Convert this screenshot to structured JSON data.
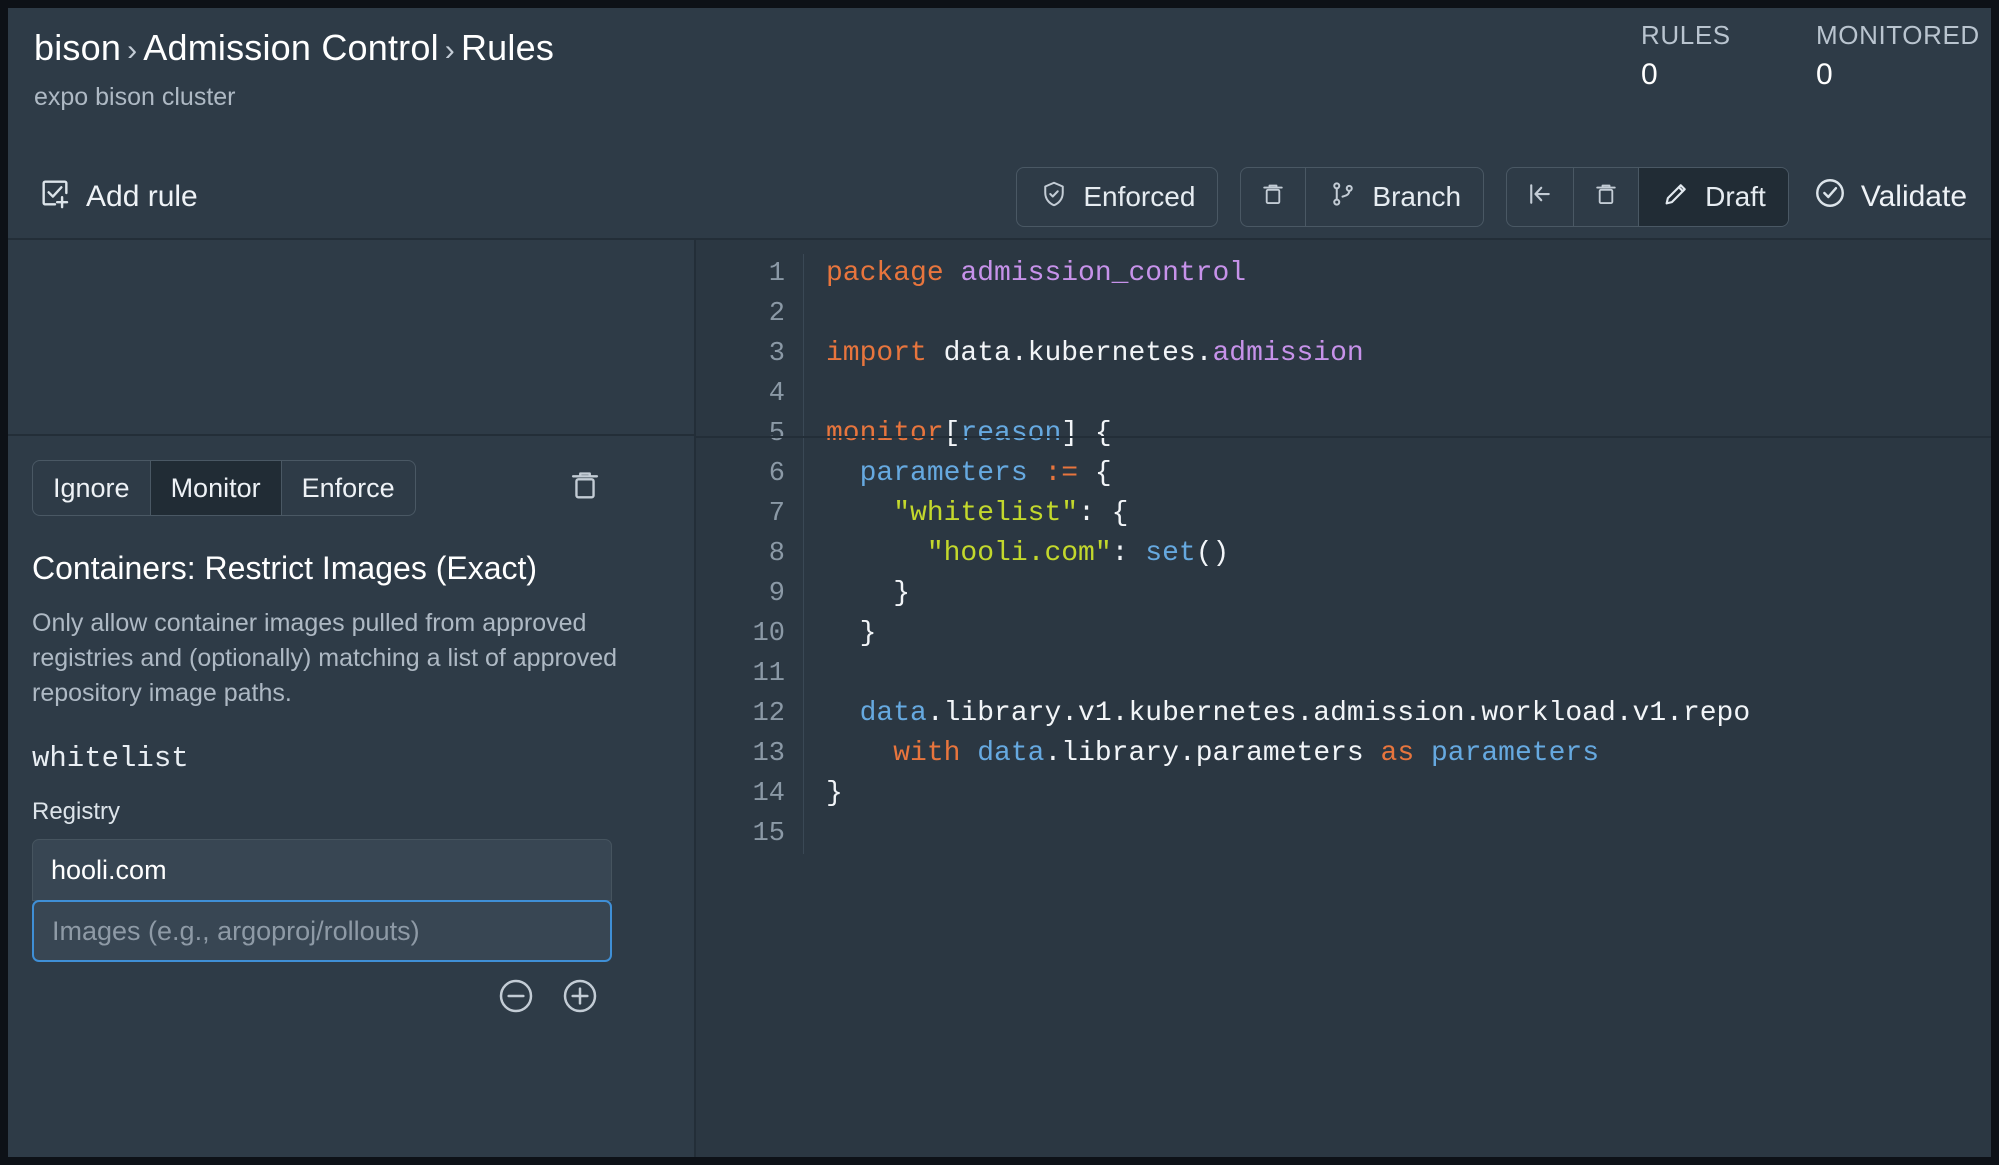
{
  "header": {
    "breadcrumb": [
      "bison",
      "Admission Control",
      "Rules"
    ],
    "separator": "›",
    "subtitle": "expo bison cluster",
    "stats": [
      {
        "label": "RULES",
        "value": "0"
      },
      {
        "label": "MONITORED",
        "value": "0"
      }
    ]
  },
  "toolbar": {
    "add_rule": "Add rule",
    "enforced": "Enforced",
    "branch": "Branch",
    "draft": "Draft",
    "validate": "Validate"
  },
  "rule": {
    "modes": [
      "Ignore",
      "Monitor",
      "Enforce"
    ],
    "active_mode": "Monitor",
    "title": "Containers: Restrict Images (Exact)",
    "description": "Only allow container images pulled from approved registries and (optionally) matching a list of approved repository image paths.",
    "param_name": "whitelist",
    "field_label": "Registry",
    "registry_value": "hooli.com",
    "images_placeholder": "Images (e.g., argoproj/rollouts)"
  },
  "editor": {
    "line_numbers": [
      "1",
      "2",
      "3",
      "4",
      "5",
      "6",
      "7",
      "8",
      "9",
      "10",
      "11",
      "12",
      "13",
      "14",
      "15"
    ],
    "lines": [
      [
        {
          "t": "package",
          "c": "kw"
        },
        {
          "t": " ",
          "c": "def"
        },
        {
          "t": "admission_control",
          "c": "pkg"
        }
      ],
      [],
      [
        {
          "t": "import",
          "c": "kw"
        },
        {
          "t": " data.kubernetes.",
          "c": "def"
        },
        {
          "t": "admission",
          "c": "pkg"
        }
      ],
      [],
      [
        {
          "t": "monitor",
          "c": "op"
        },
        {
          "t": "[",
          "c": "def"
        },
        {
          "t": "reason",
          "c": "var"
        },
        {
          "t": "] {",
          "c": "def"
        }
      ],
      [
        {
          "t": "  ",
          "c": "def"
        },
        {
          "t": "parameters",
          "c": "var"
        },
        {
          "t": " ",
          "c": "def"
        },
        {
          "t": ":=",
          "c": "op"
        },
        {
          "t": " {",
          "c": "def"
        }
      ],
      [
        {
          "t": "    ",
          "c": "def"
        },
        {
          "t": "\"whitelist\"",
          "c": "str"
        },
        {
          "t": ": {",
          "c": "def"
        }
      ],
      [
        {
          "t": "      ",
          "c": "def"
        },
        {
          "t": "\"hooli.com\"",
          "c": "str"
        },
        {
          "t": ": ",
          "c": "def"
        },
        {
          "t": "set",
          "c": "fn"
        },
        {
          "t": "()",
          "c": "def"
        }
      ],
      [
        {
          "t": "    }",
          "c": "def"
        }
      ],
      [
        {
          "t": "  }",
          "c": "def"
        }
      ],
      [],
      [
        {
          "t": "  ",
          "c": "def"
        },
        {
          "t": "data",
          "c": "var"
        },
        {
          "t": ".library.v1.kubernetes.admission.workload.v1.repo",
          "c": "def"
        }
      ],
      [
        {
          "t": "    ",
          "c": "def"
        },
        {
          "t": "with",
          "c": "kw"
        },
        {
          "t": " ",
          "c": "def"
        },
        {
          "t": "data",
          "c": "var"
        },
        {
          "t": ".library.parameters",
          "c": "def"
        },
        {
          "t": " ",
          "c": "def"
        },
        {
          "t": "as",
          "c": "kw"
        },
        {
          "t": " ",
          "c": "def"
        },
        {
          "t": "parameters",
          "c": "var"
        }
      ],
      [
        {
          "t": "}",
          "c": "def"
        }
      ],
      []
    ]
  },
  "colors": {
    "bg": "#2e3b47",
    "editor_bg": "#2b3742",
    "accent_focus": "#3f8fd6",
    "active_seg": "#212c35",
    "keyword": "#e8753d",
    "package": "#c792ea",
    "variable": "#66a9e0",
    "string": "#c3d82c"
  },
  "icons": {
    "add_rule": "checkbox-plus-icon",
    "enforced": "shield-check-icon",
    "delete_branch": "trash-icon",
    "branch": "git-branch-icon",
    "revert": "revert-to-start-icon",
    "delete_draft": "trash-icon",
    "draft": "pencil-icon",
    "validate": "circle-check-icon",
    "card_delete": "trash-icon",
    "remove_entry": "minus-circle-icon",
    "add_entry": "plus-circle-icon"
  }
}
